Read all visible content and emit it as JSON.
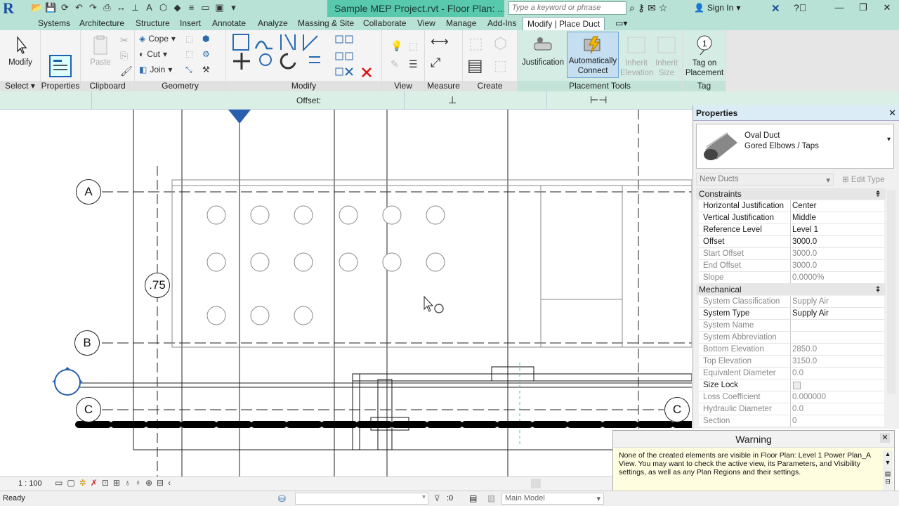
{
  "app": {
    "logo": "R",
    "document_title": "Sample MEP Project.rvt - Floor Plan: ...",
    "search_placeholder": "Type a keyword or phrase",
    "sign_in": "Sign In"
  },
  "tabs": [
    "Systems",
    "Architecture",
    "Structure",
    "Insert",
    "Annotate",
    "Analyze",
    "Massing & Site",
    "Collaborate",
    "View",
    "Manage",
    "Add-Ins",
    "Modify | Place Duct"
  ],
  "ribbon": {
    "select": {
      "modify_label": "Modify",
      "panel": "Select"
    },
    "properties": {
      "panel": "Properties"
    },
    "clipboard": {
      "paste": "Paste",
      "panel": "Clipboard"
    },
    "geometry": {
      "cope": "Cope",
      "cut": "Cut",
      "join": "Join",
      "panel": "Geometry"
    },
    "modify": {
      "panel": "Modify"
    },
    "view": {
      "panel": "View"
    },
    "measure": {
      "panel": "Measure"
    },
    "create": {
      "panel": "Create"
    },
    "placement": {
      "justification": "Justification",
      "auto_connect_1": "Automatically",
      "auto_connect_2": "Connect",
      "inherit_elev_1": "Inherit",
      "inherit_elev_2": "Elevation",
      "inherit_size_1": "Inherit",
      "inherit_size_2": "Size",
      "panel": "Placement Tools"
    },
    "tag": {
      "tag_1": "Tag on",
      "tag_2": "Placement",
      "panel": "Tag"
    }
  },
  "options_bar": {
    "offset_label": "Offset:"
  },
  "canvas": {
    "grid_a": "A",
    "grid_b": "B",
    "grid_c": "C",
    "grid_c_right": "C",
    "scale_bubble": ".75"
  },
  "properties": {
    "title": "Properties",
    "type_name": "Oval Duct",
    "type_sub": "Gored Elbows / Taps",
    "instance_filter": "New Ducts",
    "edit_type": "Edit Type",
    "groups": [
      {
        "name": "Constraints",
        "rows": [
          {
            "k": "Horizontal Justification",
            "v": "Center",
            "dim": false
          },
          {
            "k": "Vertical Justification",
            "v": "Middle",
            "dim": false
          },
          {
            "k": "Reference Level",
            "v": "Level 1",
            "dim": false
          },
          {
            "k": "Offset",
            "v": "3000.0",
            "dim": false
          },
          {
            "k": "Start Offset",
            "v": "3000.0",
            "dim": true
          },
          {
            "k": "End Offset",
            "v": "3000.0",
            "dim": true
          },
          {
            "k": "Slope",
            "v": "0.0000%",
            "dim": true
          }
        ]
      },
      {
        "name": "Mechanical",
        "rows": [
          {
            "k": "System Classification",
            "v": "Supply Air",
            "dim": true
          },
          {
            "k": "System Type",
            "v": "Supply Air",
            "dim": false
          },
          {
            "k": "System Name",
            "v": "",
            "dim": true
          },
          {
            "k": "System Abbreviation",
            "v": "",
            "dim": true
          },
          {
            "k": "Bottom Elevation",
            "v": "2850.0",
            "dim": true
          },
          {
            "k": "Top Elevation",
            "v": "3150.0",
            "dim": true
          },
          {
            "k": "Equivalent Diameter",
            "v": "0.0",
            "dim": true
          },
          {
            "k": "Size Lock",
            "v": "",
            "dim": false
          },
          {
            "k": "Loss Coefficient",
            "v": "0.000000",
            "dim": true
          },
          {
            "k": "Hydraulic Diameter",
            "v": "0.0",
            "dim": true
          },
          {
            "k": "Section",
            "v": "0",
            "dim": true
          }
        ]
      }
    ]
  },
  "warning": {
    "title": "Warning",
    "text": "None of the created elements are visible in Floor Plan: Level 1 Power Plan_A View. You may want to check the active view, its Parameters, and Visibility settings, as well as any Plan Regions and their settings."
  },
  "view_bar": {
    "scale": "1 : 100"
  },
  "status": {
    "ready": "Ready",
    "selection_count": ":0",
    "model": "Main Model"
  }
}
